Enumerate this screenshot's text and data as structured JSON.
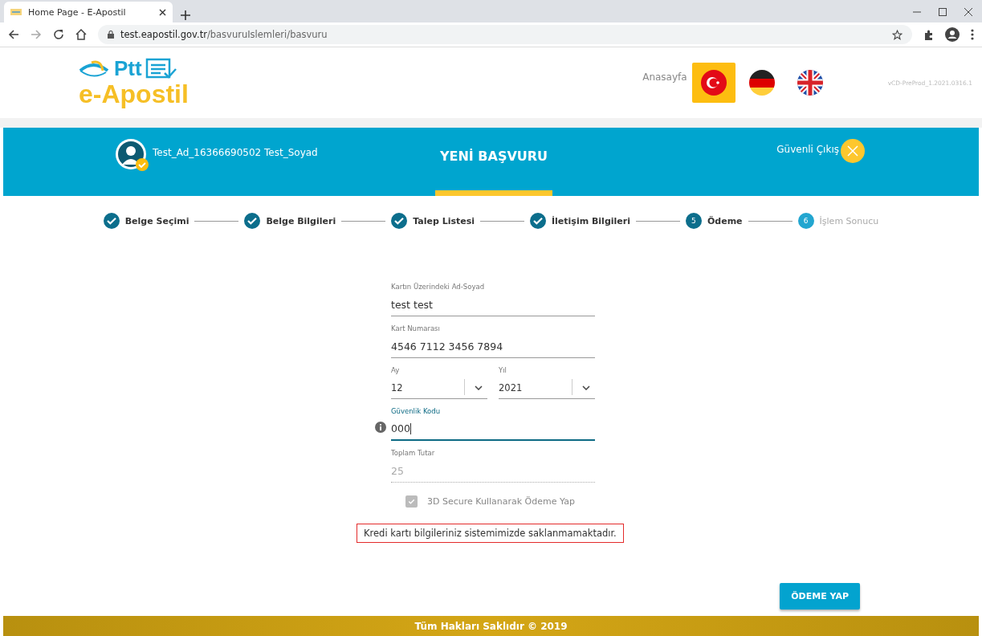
{
  "browser": {
    "tab_title": "Home Page - E-Apostil",
    "url_host": "test.eapostil.gov.tr",
    "url_path": "/basvuruIslemleri/basvuru"
  },
  "header": {
    "logo_top": "Ptt",
    "logo_bottom": "e-Apostil",
    "home_link": "Anasayfa",
    "version": "vCD-PreProd_1.2021.0316.1",
    "languages": [
      {
        "kind": "tr",
        "selected": true
      },
      {
        "kind": "de",
        "selected": false
      },
      {
        "kind": "en",
        "selected": false
      }
    ]
  },
  "banner": {
    "user": "Test_Ad_16366690502 Test_Soyad",
    "title": "YENİ BAŞVURU",
    "logout": "Güvenli Çıkış"
  },
  "steps": [
    {
      "label": "Belge Seçimi",
      "kind": "done"
    },
    {
      "label": "Belge Bilgileri",
      "kind": "done"
    },
    {
      "label": "Talep Listesi",
      "kind": "done"
    },
    {
      "label": "İletişim Bilgileri",
      "kind": "done"
    },
    {
      "label": "Ödeme",
      "kind": "current",
      "number": "5"
    },
    {
      "label": "İşlem Sonucu",
      "kind": "upcoming",
      "number": "6"
    }
  ],
  "form": {
    "fields": [
      {
        "kind": "text",
        "label": "Kartın Üzerindeki Ad-Soyad",
        "value": "test test",
        "focused": false,
        "disabled": false
      },
      {
        "kind": "text",
        "label": "Kart Numarası",
        "value": "4546 7112 3456 7894",
        "focused": false,
        "disabled": false
      },
      {
        "kind": "selects",
        "items": [
          {
            "label": "Ay",
            "value": "12"
          },
          {
            "label": "Yıl",
            "value": "2021"
          }
        ]
      },
      {
        "kind": "text",
        "label": "Güvenlik Kodu",
        "value": "000",
        "focused": true,
        "disabled": false,
        "info": true
      },
      {
        "kind": "text",
        "label": "Toplam Tutar",
        "value": "25",
        "focused": false,
        "disabled": true
      }
    ],
    "secure": {
      "label": "3D Secure Kullanarak Ödeme Yap",
      "checked": true,
      "disabled": true
    },
    "notice": "Kredi kartı bilgileriniz sistemimizde saklanmamaktadır.",
    "submit": "ÖDEME YAP"
  },
  "footer": "Tüm Hakları Saklıdır © 2019"
}
